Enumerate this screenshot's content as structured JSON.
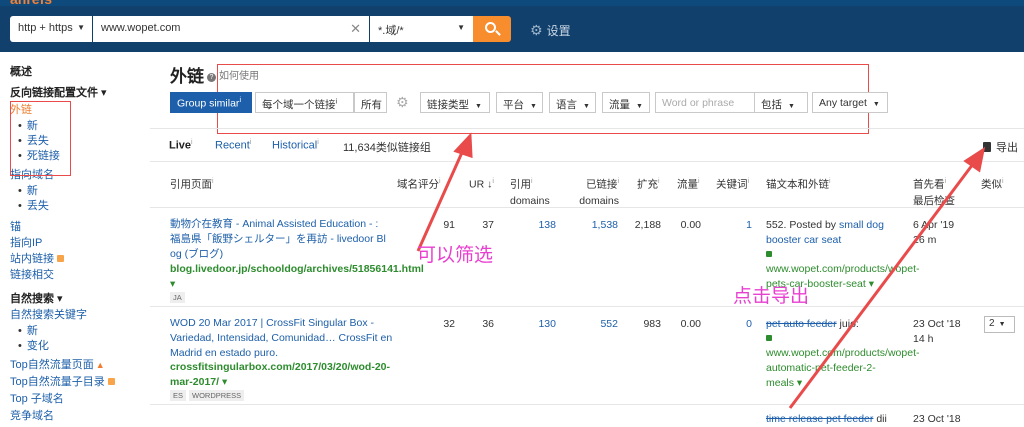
{
  "header": {
    "protocol": "http + https",
    "url": "www.wopet.com",
    "mode": "*.域/*",
    "settings_label": "设置"
  },
  "sidebar": {
    "overview": "概述",
    "backlink_profile": "反向链接配置文件 ▾",
    "outlinks": "外链",
    "outlinks_sub": [
      "新",
      "丢失",
      "死链接"
    ],
    "domains": "指向域名",
    "domains_sub": [
      "新",
      "丢失"
    ],
    "anchors": "锚",
    "ip": "指向IP",
    "internal": "站内链接",
    "related": "链接相交",
    "organic": "自然搜索 ▾",
    "organic_kw": "自然搜索关键字",
    "organic_sub": [
      "新",
      "变化"
    ],
    "top_pages": "Top自然流量页面",
    "top_dirs": "Top自然流量子目录",
    "top_subdomains": "Top 子域名",
    "competitors": "竞争域名"
  },
  "page": {
    "title": "外链",
    "howto": "如何使用"
  },
  "filters": {
    "group_similar": "Group similar",
    "one_per_domain": "每个域一个链接",
    "all": "所有",
    "link_type": "链接类型",
    "platform": "平台",
    "language": "语言",
    "traffic": "流量",
    "word_placeholder": "Word or phrase",
    "include": "包括",
    "any_target": "Any target"
  },
  "tabs": {
    "live": "Live",
    "recent": "Recent",
    "historical": "Historical",
    "count": "11,634类似链接组",
    "export": "导出"
  },
  "columns": {
    "ref_page": "引用页面",
    "dr": "域名评分",
    "ur": "UR ↓",
    "ref_domains_1": "引用",
    "ref_domains_2": "domains",
    "linked_domains_1": "已链接",
    "linked_domains_2": "domains",
    "ext": "扩充",
    "traffic": "流量",
    "kw": "关键词",
    "anchor": "锚文本和外链",
    "first_seen_1": "首先看",
    "first_seen_2": "最后检查",
    "similar": "类似"
  },
  "rows": [
    {
      "title": "動物介在教育 - Animal Assisted Education - : 福島県「飯野シェルター」を再訪 - livedoor Bl og (ブログ)",
      "url": "blog.livedoor.jp/schooldog/archives/51856141.html ▾",
      "tags": [
        "JA"
      ],
      "dr": "91",
      "ur": "37",
      "ref_domains": "138",
      "linked_domains": "1,538",
      "ext": "2,188",
      "traffic": "0.00",
      "kw": "1",
      "anchor_prefix": "552. Posted by ",
      "anchor_link": "small dog booster car seat",
      "target": "www.wopet.com/products/wopet-pets-car-booster-seat ▾",
      "first_seen": "6 Apr '19",
      "last_check": "26 m",
      "similar": ""
    },
    {
      "title": "WOD 20 Mar 2017 | CrossFit Singular Box - Variedad, Intensidad, Comunidad… CrossFit en Madrid en estado puro.",
      "url": "crossfitsingularbox.com/2017/03/20/wod-20-mar-2017/ ▾",
      "tags": [
        "ES",
        "WORDPRESS"
      ],
      "dr": "32",
      "ur": "36",
      "ref_domains": "130",
      "linked_domains": "552",
      "ext": "983",
      "traffic": "0.00",
      "kw": "0",
      "anchor_link": "pet auto feeder",
      "anchor_suffix": " jujo:",
      "target": "www.wopet.com/products/wopet-automatic-pet-feeder-2-meals ▾",
      "first_seen": "23 Oct '18",
      "last_check": "14 h",
      "similar": "2"
    },
    {
      "anchor_link": "time release pet feeder",
      "anchor_suffix": " dii",
      "first_seen": "23 Oct '18"
    }
  ],
  "annotations": {
    "filter_note": "可以筛选",
    "export_note": "点击导出",
    "color": "#e83fd0",
    "box_color": "#e94b4b"
  }
}
